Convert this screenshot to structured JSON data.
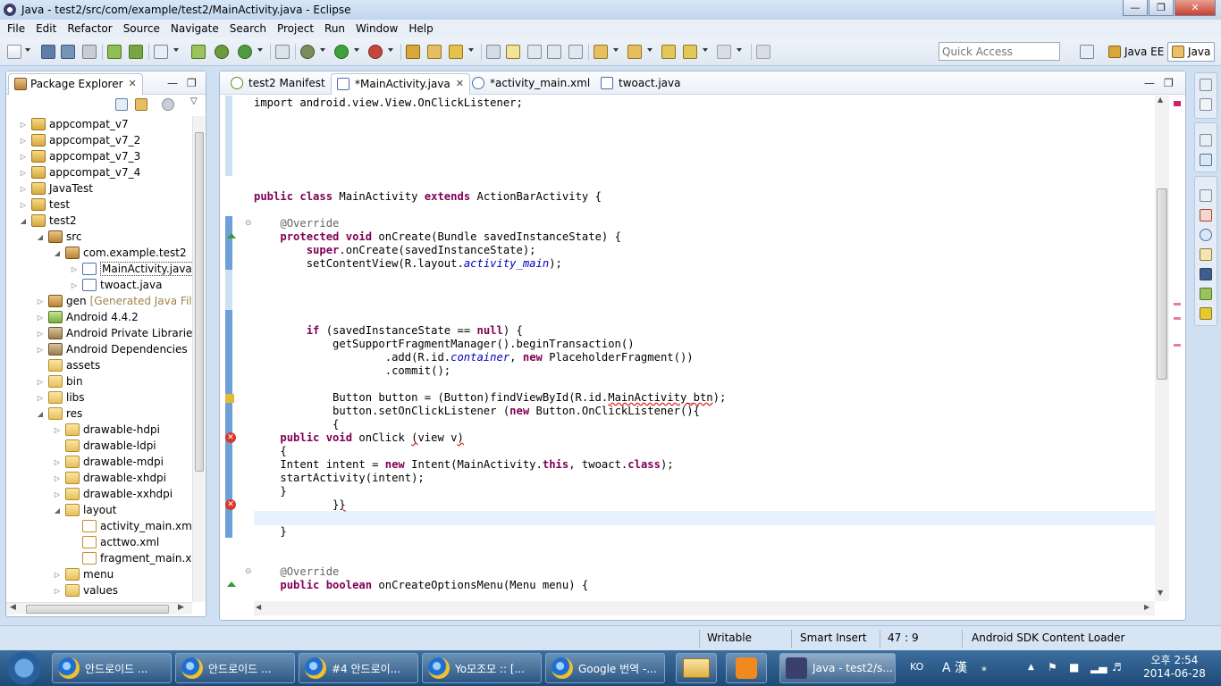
{
  "window": {
    "title": "Java - test2/src/com/example/test2/MainActivity.java - Eclipse"
  },
  "menu": [
    "File",
    "Edit",
    "Refactor",
    "Source",
    "Navigate",
    "Search",
    "Project",
    "Run",
    "Window",
    "Help"
  ],
  "toolbar": {
    "quick_access_placeholder": "Quick Access"
  },
  "perspectives": [
    {
      "label": "Java EE"
    },
    {
      "label": "Java"
    }
  ],
  "package_explorer": {
    "title": "Package Explorer",
    "tree": [
      {
        "label": "appcompat_v7",
        "depth": 0,
        "twisty": "collapsed",
        "icon": "project"
      },
      {
        "label": "appcompat_v7_2",
        "depth": 0,
        "twisty": "collapsed",
        "icon": "project"
      },
      {
        "label": "appcompat_v7_3",
        "depth": 0,
        "twisty": "collapsed",
        "icon": "project"
      },
      {
        "label": "appcompat_v7_4",
        "depth": 0,
        "twisty": "collapsed",
        "icon": "project"
      },
      {
        "label": "JavaTest",
        "depth": 0,
        "twisty": "collapsed",
        "icon": "project"
      },
      {
        "label": "test",
        "depth": 0,
        "twisty": "collapsed",
        "icon": "project"
      },
      {
        "label": "test2",
        "depth": 0,
        "twisty": "expanded",
        "icon": "project"
      },
      {
        "label": "src",
        "depth": 1,
        "twisty": "expanded",
        "icon": "package"
      },
      {
        "label": "com.example.test2",
        "depth": 2,
        "twisty": "expanded",
        "icon": "package"
      },
      {
        "label": "MainActivity.java",
        "depth": 3,
        "twisty": "collapsed",
        "icon": "java",
        "selected": true
      },
      {
        "label": "twoact.java",
        "depth": 3,
        "twisty": "collapsed",
        "icon": "java"
      },
      {
        "label": "gen",
        "depth": 1,
        "twisty": "collapsed",
        "icon": "package",
        "note": "[Generated Java Files]"
      },
      {
        "label": "Android 4.4.2",
        "depth": 1,
        "twisty": "collapsed",
        "icon": "android"
      },
      {
        "label": "Android Private Libraries",
        "depth": 1,
        "twisty": "collapsed",
        "icon": "lib"
      },
      {
        "label": "Android Dependencies",
        "depth": 1,
        "twisty": "collapsed",
        "icon": "lib"
      },
      {
        "label": "assets",
        "depth": 1,
        "twisty": "none",
        "icon": "folder"
      },
      {
        "label": "bin",
        "depth": 1,
        "twisty": "collapsed",
        "icon": "folder"
      },
      {
        "label": "libs",
        "depth": 1,
        "twisty": "collapsed",
        "icon": "folder"
      },
      {
        "label": "res",
        "depth": 1,
        "twisty": "expanded",
        "icon": "folder"
      },
      {
        "label": "drawable-hdpi",
        "depth": 2,
        "twisty": "collapsed",
        "icon": "folder"
      },
      {
        "label": "drawable-ldpi",
        "depth": 2,
        "twisty": "none",
        "icon": "folder"
      },
      {
        "label": "drawable-mdpi",
        "depth": 2,
        "twisty": "collapsed",
        "icon": "folder"
      },
      {
        "label": "drawable-xhdpi",
        "depth": 2,
        "twisty": "collapsed",
        "icon": "folder"
      },
      {
        "label": "drawable-xxhdpi",
        "depth": 2,
        "twisty": "collapsed",
        "icon": "folder"
      },
      {
        "label": "layout",
        "depth": 2,
        "twisty": "expanded",
        "icon": "folder"
      },
      {
        "label": "activity_main.xml",
        "depth": 3,
        "twisty": "none",
        "icon": "xml"
      },
      {
        "label": "acttwo.xml",
        "depth": 3,
        "twisty": "none",
        "icon": "xml"
      },
      {
        "label": "fragment_main.xml",
        "depth": 3,
        "twisty": "none",
        "icon": "xml"
      },
      {
        "label": "menu",
        "depth": 2,
        "twisty": "collapsed",
        "icon": "folder"
      },
      {
        "label": "values",
        "depth": 2,
        "twisty": "collapsed",
        "icon": "folder"
      }
    ]
  },
  "editor": {
    "tabs": [
      {
        "label": "test2 Manifest",
        "icon": "manifest"
      },
      {
        "label": "*MainActivity.java",
        "icon": "java",
        "active": true
      },
      {
        "label": "*activity_main.xml",
        "icon": "xml"
      },
      {
        "label": "twoact.java",
        "icon": "java"
      }
    ],
    "code": [
      {
        "line": 0,
        "html": "import android.view.View.OnClickListener;"
      },
      {
        "line": 7,
        "html": "<span class=\"kw\">public class</span> MainActivity <span class=\"kw\">extends</span> ActionBarActivity {"
      },
      {
        "line": 9,
        "html": "    <span class=\"ann\">@Override</span>"
      },
      {
        "line": 10,
        "html": "    <span class=\"kw\">protected void</span> onCreate(Bundle savedInstanceState) {"
      },
      {
        "line": 11,
        "html": "        <span class=\"kw\">super</span>.onCreate(savedInstanceState);"
      },
      {
        "line": 12,
        "html": "        setContentView(R.layout.<span class=\"fld\">activity_main</span>);"
      },
      {
        "line": 17,
        "html": "        <span class=\"kw\">if</span> (savedInstanceState == <span class=\"kw\">null</span>) {"
      },
      {
        "line": 18,
        "html": "            getSupportFragmentManager().beginTransaction()"
      },
      {
        "line": 19,
        "html": "                    .add(R.id.<span class=\"fld\">container</span>, <span class=\"kw\">new</span> PlaceholderFragment())"
      },
      {
        "line": 20,
        "html": "                    .commit();"
      },
      {
        "line": 22,
        "html": "            Button button = (Button)findViewById(R.id.<span class=\"squig\">MainActivity_btn</span>);"
      },
      {
        "line": 23,
        "html": "            button.setOnClickListener (<span class=\"kw\">new</span> Button.OnClickListener(){"
      },
      {
        "line": 24,
        "html": "            {"
      },
      {
        "line": 25,
        "html": "    <span class=\"kw\">public void</span> onClick <span class=\"squig\">(</span>view v<span class=\"squig\">)</span>"
      },
      {
        "line": 26,
        "html": "    {"
      },
      {
        "line": 27,
        "html": "    Intent intent = <span class=\"kw\">new</span> Intent(MainActivity.<span class=\"kw\">this</span>, twoact.<span class=\"kw\">class</span>);"
      },
      {
        "line": 28,
        "html": "    startActivity(intent);"
      },
      {
        "line": 29,
        "html": "    }"
      },
      {
        "line": 30,
        "html": "            }<span class=\"squig\">}</span>"
      },
      {
        "line": 32,
        "html": "    }"
      },
      {
        "line": 35,
        "html": "    <span class=\"ann\">@Override</span>"
      },
      {
        "line": 36,
        "html": "    <span class=\"kw\">public boolean</span> onCreateOptionsMenu(Menu menu) {"
      }
    ]
  },
  "status": {
    "writable": "Writable",
    "insert_mode": "Smart Insert",
    "position": "47 : 9",
    "loader": "Android SDK Content Loader"
  },
  "taskbar": {
    "tasks": [
      {
        "label": "안드로이드 ...",
        "icon": "ie"
      },
      {
        "label": "안드로이드 ...",
        "icon": "ie"
      },
      {
        "label": "#4 안드로이...",
        "icon": "ie"
      },
      {
        "label": "Yo모조모 :: [...",
        "icon": "ie"
      },
      {
        "label": "Google 번역 -...",
        "icon": "ie"
      }
    ],
    "eclipse_task": {
      "label": "Java - test2/s..."
    },
    "tray": {
      "lang": "KO",
      "ime": "A 漢"
    },
    "clock": {
      "time": "오후 2:54",
      "date": "2014-06-28"
    }
  },
  "colors": {
    "keyword": "#7f0055",
    "field": "#0000c0",
    "annotation": "#646464",
    "error": "#d9382c",
    "current_line": "#e8f2fe"
  }
}
